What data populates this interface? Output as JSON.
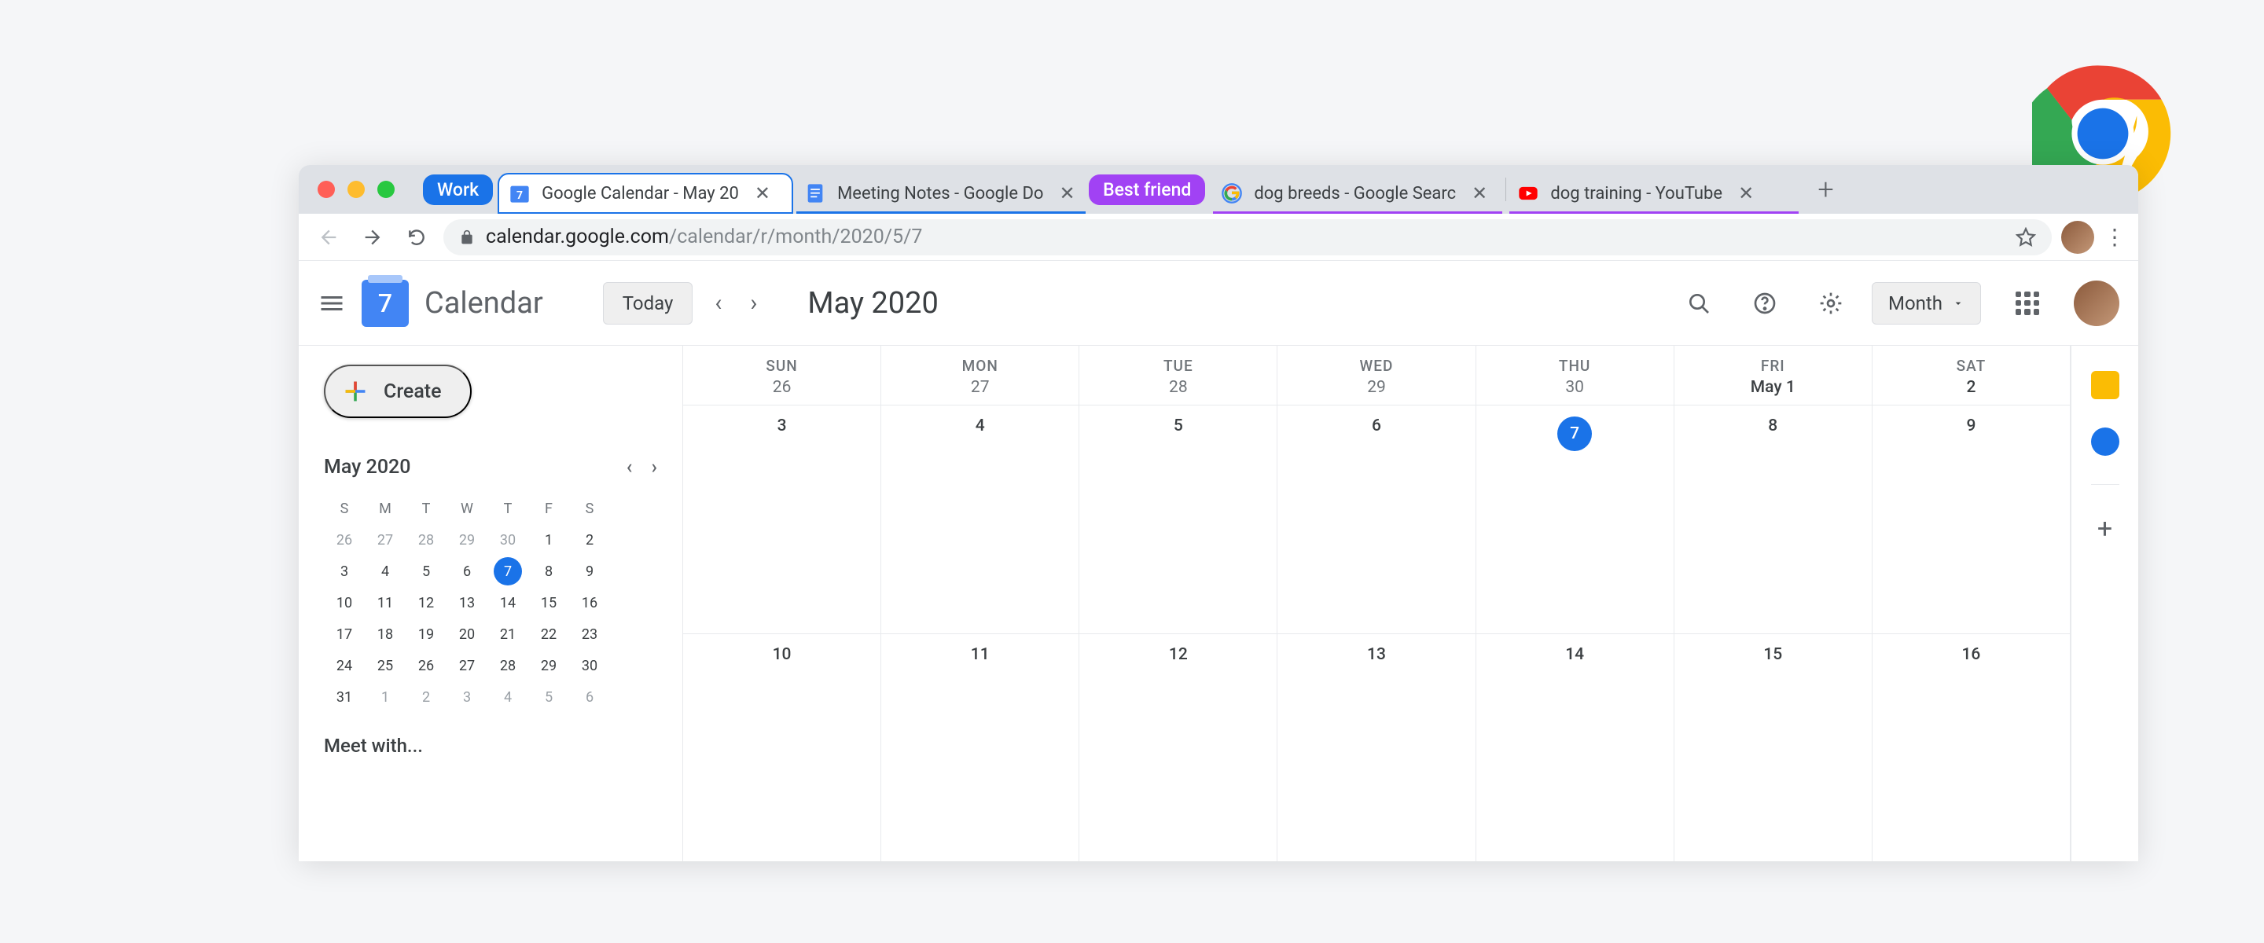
{
  "browser": {
    "tab_groups": [
      {
        "label": "Work",
        "color": "#1a73e8"
      },
      {
        "label": "Best friend",
        "color": "#a142f4"
      }
    ],
    "tabs": [
      {
        "title": "Google Calendar - May 20",
        "favicon": "calendar",
        "active": true,
        "group": 0
      },
      {
        "title": "Meeting Notes - Google Do",
        "favicon": "docs",
        "active": false,
        "group": 0
      },
      {
        "title": "dog breeds - Google Searc",
        "favicon": "google",
        "active": false,
        "group": 1
      },
      {
        "title": "dog training - YouTube",
        "favicon": "youtube",
        "active": false,
        "group": 1
      }
    ],
    "url_host": "calendar.google.com",
    "url_path": "/calendar/r/month/2020/5/7"
  },
  "header": {
    "app_name": "Calendar",
    "logo_day": "7",
    "today_button": "Today",
    "month_title": "May 2020",
    "view_button": "Month"
  },
  "create_button": "Create",
  "mini_calendar": {
    "title": "May 2020",
    "day_headers": [
      "S",
      "M",
      "T",
      "W",
      "T",
      "F",
      "S"
    ],
    "weeks": [
      [
        {
          "d": "26",
          "m": true
        },
        {
          "d": "27",
          "m": true
        },
        {
          "d": "28",
          "m": true
        },
        {
          "d": "29",
          "m": true
        },
        {
          "d": "30",
          "m": true
        },
        {
          "d": "1"
        },
        {
          "d": "2"
        }
      ],
      [
        {
          "d": "3"
        },
        {
          "d": "4"
        },
        {
          "d": "5"
        },
        {
          "d": "6"
        },
        {
          "d": "7",
          "t": true
        },
        {
          "d": "8"
        },
        {
          "d": "9"
        }
      ],
      [
        {
          "d": "10"
        },
        {
          "d": "11"
        },
        {
          "d": "12"
        },
        {
          "d": "13"
        },
        {
          "d": "14"
        },
        {
          "d": "15"
        },
        {
          "d": "16"
        }
      ],
      [
        {
          "d": "17"
        },
        {
          "d": "18"
        },
        {
          "d": "19"
        },
        {
          "d": "20"
        },
        {
          "d": "21"
        },
        {
          "d": "22"
        },
        {
          "d": "23"
        }
      ],
      [
        {
          "d": "24"
        },
        {
          "d": "25"
        },
        {
          "d": "26"
        },
        {
          "d": "27"
        },
        {
          "d": "28"
        },
        {
          "d": "29"
        },
        {
          "d": "30"
        }
      ],
      [
        {
          "d": "31"
        },
        {
          "d": "1",
          "m": true
        },
        {
          "d": "2",
          "m": true
        },
        {
          "d": "3",
          "m": true
        },
        {
          "d": "4",
          "m": true
        },
        {
          "d": "5",
          "m": true
        },
        {
          "d": "6",
          "m": true
        }
      ]
    ]
  },
  "meet_with": "Meet with...",
  "main_calendar": {
    "day_headers": [
      "SUN",
      "MON",
      "TUE",
      "WED",
      "THU",
      "FRI",
      "SAT"
    ],
    "first_row_dates": [
      "26",
      "27",
      "28",
      "29",
      "30",
      "May 1",
      "2"
    ],
    "rows": [
      [
        {
          "d": "3"
        },
        {
          "d": "4"
        },
        {
          "d": "5"
        },
        {
          "d": "6"
        },
        {
          "d": "7",
          "t": true
        },
        {
          "d": "8"
        },
        {
          "d": "9"
        }
      ],
      [
        {
          "d": "10"
        },
        {
          "d": "11"
        },
        {
          "d": "12"
        },
        {
          "d": "13"
        },
        {
          "d": "14"
        },
        {
          "d": "15"
        },
        {
          "d": "16"
        }
      ]
    ]
  }
}
